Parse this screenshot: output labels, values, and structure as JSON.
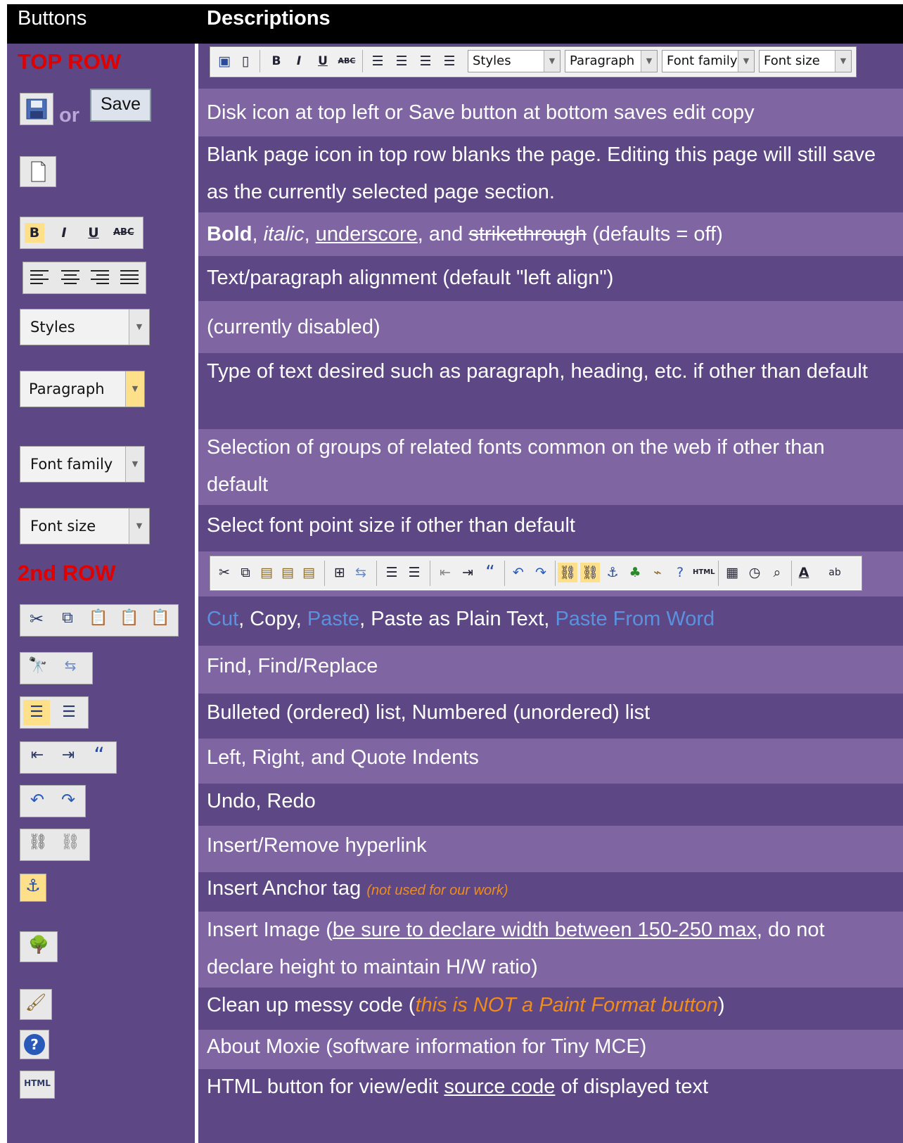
{
  "header": {
    "buttons_col": "Buttons",
    "descriptions_col": "Descriptions"
  },
  "sections": {
    "top_row": "TOP ROW",
    "second_row": "2nd ROW"
  },
  "left": {
    "or_text": "or",
    "save_label": "Save",
    "styles_select": "Styles",
    "paragraph_select": "Paragraph",
    "font_family_select": "Font family",
    "font_size_select": "Font size",
    "bold": "B",
    "italic": "I",
    "underline": "U",
    "strike": "ABC"
  },
  "toolbar_top": {
    "styles": "Styles",
    "paragraph": "Paragraph",
    "font_family": "Font family",
    "font_size": "Font size"
  },
  "rows": {
    "save": "Disk icon at top left or Save button at bottom saves edit copy",
    "blank": "Blank page icon in top row blanks the page. Editing this page will still save as the currently selected page section.",
    "format": {
      "bold": "Bold",
      "sep1": ", ",
      "italic": "italic",
      "sep2": ", ",
      "underscore": "underscore",
      "sep3": ", and ",
      "strike": "strikethrough",
      "rest": " (defaults = off)"
    },
    "align": "Text/paragraph alignment (default \"left align\")",
    "styles": "(currently disabled)",
    "paragraph": "Type of text desired such as paragraph, heading, etc. if other than default",
    "family": "Selection of groups of related fonts common on the web if other than default",
    "size": "Select font point size if other than default",
    "cut": {
      "cut": "Cut",
      "s1": ", Copy, ",
      "paste": "Paste",
      "s2": ", Paste as Plain Text, ",
      "word": "Paste From Word"
    },
    "find": "Find, Find/Replace",
    "lists": "Bulleted (ordered) list, Numbered (unordered) list",
    "indent": "Left, Right, and Quote Indents",
    "undo": "Undo, Redo",
    "link": "Insert/Remove hyperlink",
    "anchor": {
      "main": "Insert Anchor tag ",
      "note": "(not used for our work)"
    },
    "image": {
      "a": "Insert Image (",
      "u": "be sure to declare width between 150-250 max",
      "b": ", do not declare height to maintain H/W ratio)"
    },
    "cleanup": {
      "a": "Clean up messy code (",
      "o": "this is NOT a Paint Format button",
      "b": ")"
    },
    "about": "About Moxie (software information for Tiny MCE)",
    "html": {
      "a": "HTML button for view/edit ",
      "u": "source code",
      "b": " of displayed text"
    }
  },
  "icons": {
    "save": "save-disk-icon",
    "new": "blank-page-icon",
    "cut": "scissors-icon",
    "anchor": "anchor-icon",
    "image": "tree-image-icon",
    "cleanup": "broom-icon",
    "about": "question-icon",
    "html": "html-icon",
    "html_text": "HTML"
  },
  "colors": {
    "dark_row": "#5d4784",
    "light_row": "#8065a3",
    "section_label": "#e00000",
    "highlight": "#5a92e0",
    "orange_note": "#f08c1a"
  }
}
